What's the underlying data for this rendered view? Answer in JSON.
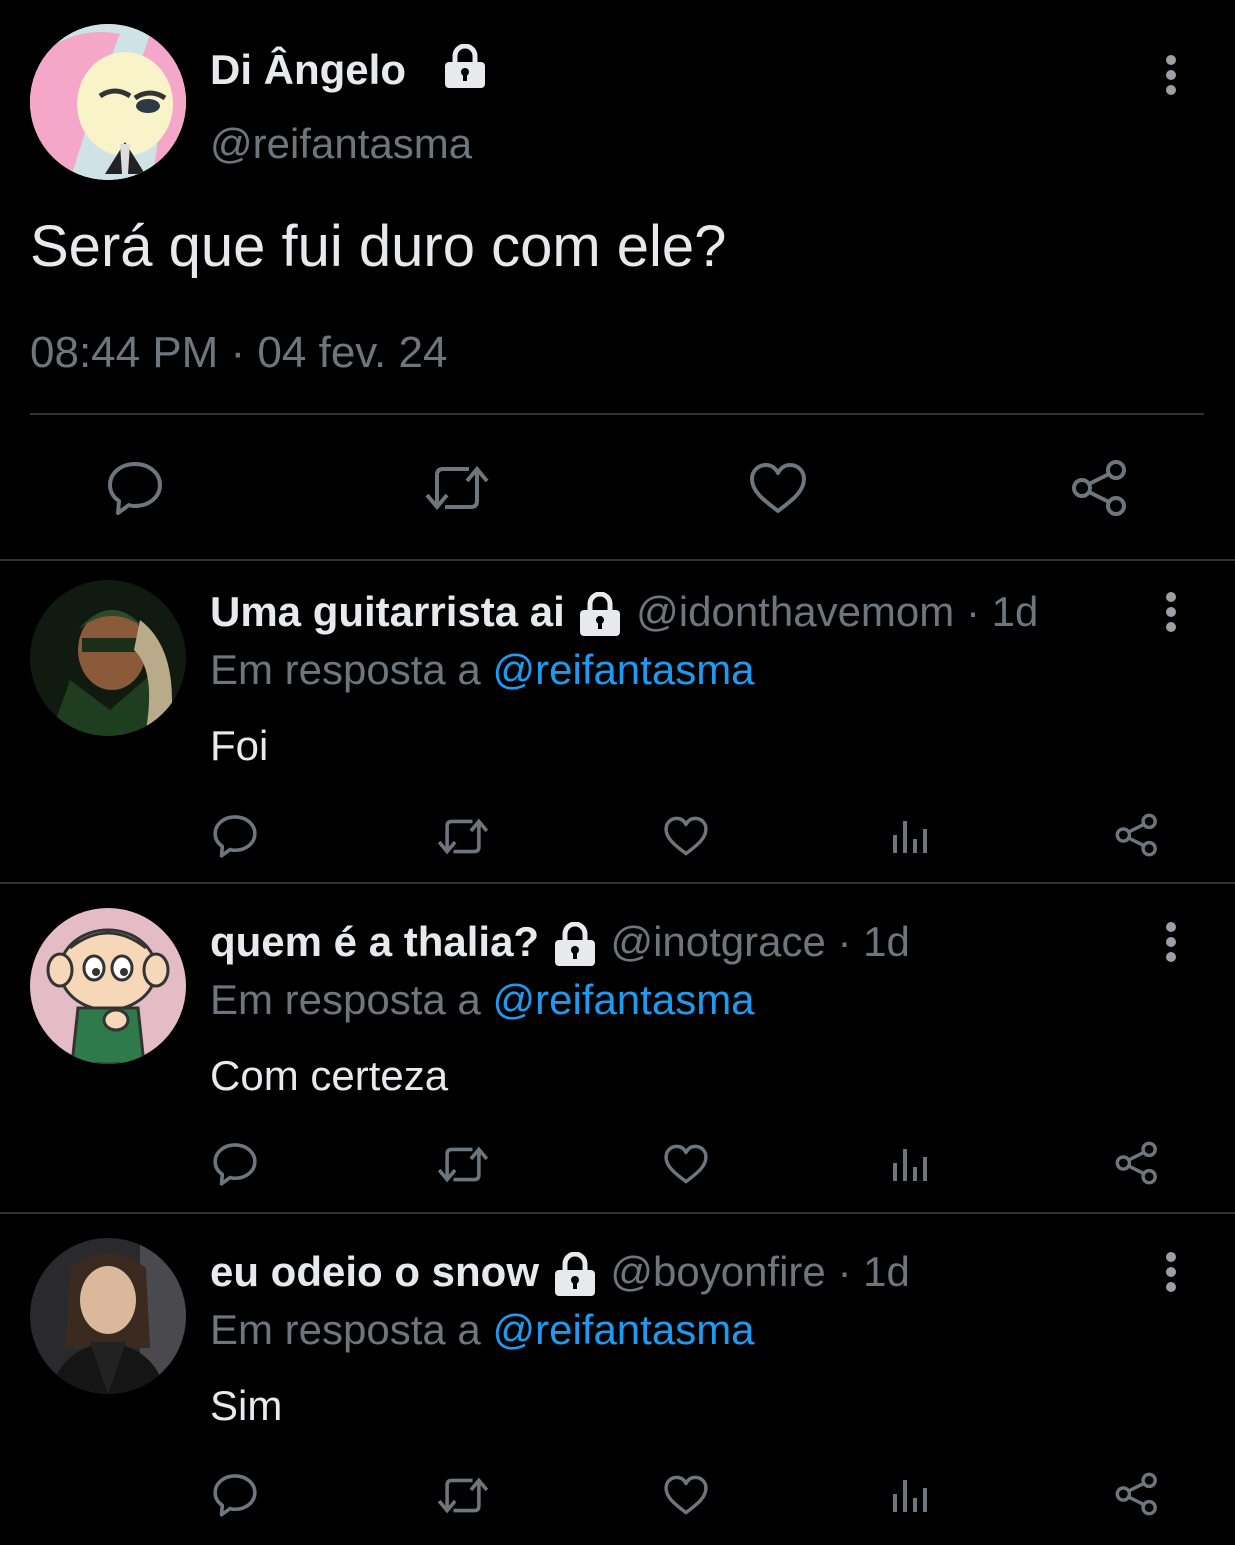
{
  "main_tweet": {
    "display_name": "Di Ângelo",
    "handle": "@reifantasma",
    "text": "Será que fui duro com ele?",
    "timestamp": "08:44 PM · 04 fev. 24",
    "icons": [
      "lock-icon",
      "more-icon",
      "reply-icon",
      "retweet-icon",
      "like-icon",
      "share-icon"
    ]
  },
  "replies": [
    {
      "display_name": "Uma guitarrista ai",
      "handle": "@idonthavemom",
      "age": "· 1d",
      "reply_prefix": "Em resposta a",
      "reply_to": "@reifantasma",
      "text": "Foi"
    },
    {
      "display_name": "quem é a thalia?",
      "handle": "@inotgrace",
      "age": "· 1d",
      "reply_prefix": "Em resposta a",
      "reply_to": "@reifantasma",
      "text": "Com certeza"
    },
    {
      "display_name": "eu odeio o snow",
      "handle": "@boyonfire",
      "age": "· 1d",
      "reply_prefix": "Em resposta a",
      "reply_to": "@reifantasma",
      "text": "Sim"
    }
  ],
  "colors": {
    "background": "#000000",
    "text": "#e7e9ea",
    "muted": "#6e767d",
    "link": "#1d9bf0",
    "divider": "#2f3336"
  }
}
